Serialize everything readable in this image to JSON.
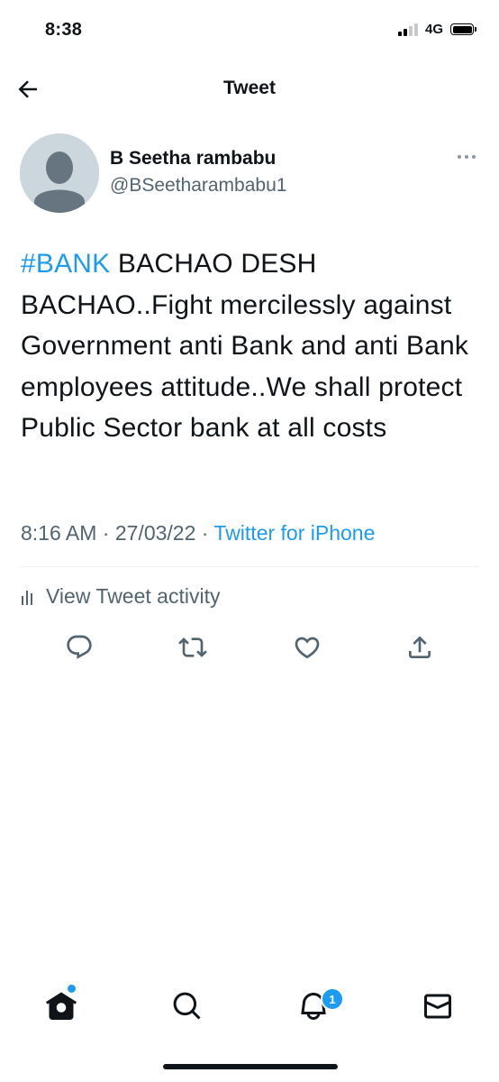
{
  "status_bar": {
    "time": "8:38",
    "network": "4G",
    "signal_bars": 2,
    "battery_level": 1.0
  },
  "header": {
    "title": "Tweet",
    "back_icon": "arrow-left-icon"
  },
  "tweet": {
    "author": {
      "name": "B Seetha rambabu",
      "handle": "@BSeetharambabu1",
      "avatar_icon": "default-avatar-icon"
    },
    "hashtag": "#BANK",
    "text": " BACHAO DESH BACHAO..Fight mercilessly against Government anti Bank and anti Bank employees attitude..We shall protect Public Sector bank at all costs",
    "time": "8:16 AM",
    "date": "27/03/22",
    "separator": "·",
    "source": "Twitter for iPhone",
    "activity_label": "View Tweet activity",
    "actions": [
      "reply-icon",
      "retweet-icon",
      "like-icon",
      "share-icon"
    ]
  },
  "bottom_nav": {
    "items": [
      "home-icon",
      "search-icon",
      "notifications-icon",
      "messages-icon"
    ],
    "notification_count": "1"
  },
  "colors": {
    "accent": "#1d9bf0",
    "text": "#0f1419",
    "secondary_text": "#536471",
    "divider": "#eff3f4"
  }
}
